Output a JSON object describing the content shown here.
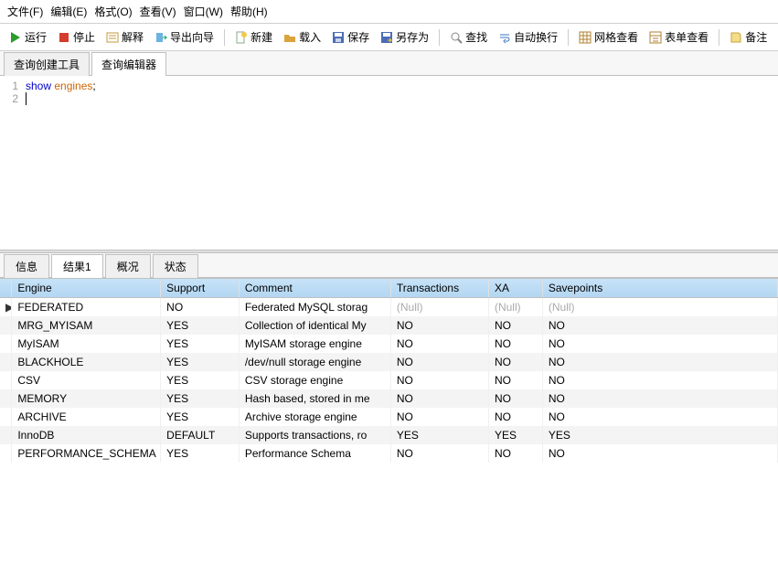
{
  "menu": {
    "file": "文件(F)",
    "edit": "编辑(E)",
    "format": "格式(O)",
    "view": "查看(V)",
    "window": "窗口(W)",
    "help": "帮助(H)"
  },
  "toolbar": {
    "run": "运行",
    "stop": "停止",
    "explain": "解释",
    "export_wizard": "导出向导",
    "new": "新建",
    "load": "载入",
    "save": "保存",
    "saveas": "另存为",
    "find": "查找",
    "wrap": "自动换行",
    "gridview": "网格查看",
    "formview": "表单查看",
    "note": "备注"
  },
  "editor_tabs": {
    "builder": "查询创建工具",
    "editor": "查询编辑器"
  },
  "code": {
    "lines": [
      {
        "n": "1",
        "tokens": [
          [
            "show ",
            "kw1"
          ],
          [
            "engines",
            "kw2"
          ],
          [
            ";",
            ""
          ]
        ]
      },
      {
        "n": "2",
        "tokens": []
      }
    ]
  },
  "result_tabs": {
    "info": "信息",
    "r1": "结果1",
    "profile": "概况",
    "status": "状态"
  },
  "columns": [
    "Engine",
    "Support",
    "Comment",
    "Transactions",
    "XA",
    "Savepoints"
  ],
  "rows": [
    {
      "mark": "▶",
      "cells": [
        "FEDERATED",
        "NO",
        "Federated MySQL storag",
        "(Null)",
        "(Null)",
        "(Null)"
      ]
    },
    {
      "mark": "",
      "cells": [
        "MRG_MYISAM",
        "YES",
        "Collection of identical My",
        "NO",
        "NO",
        "NO"
      ]
    },
    {
      "mark": "",
      "cells": [
        "MyISAM",
        "YES",
        "MyISAM storage engine",
        "NO",
        "NO",
        "NO"
      ]
    },
    {
      "mark": "",
      "cells": [
        "BLACKHOLE",
        "YES",
        "/dev/null storage engine",
        "NO",
        "NO",
        "NO"
      ]
    },
    {
      "mark": "",
      "cells": [
        "CSV",
        "YES",
        "CSV storage engine",
        "NO",
        "NO",
        "NO"
      ]
    },
    {
      "mark": "",
      "cells": [
        "MEMORY",
        "YES",
        "Hash based, stored in me",
        "NO",
        "NO",
        "NO"
      ]
    },
    {
      "mark": "",
      "cells": [
        "ARCHIVE",
        "YES",
        "Archive storage engine",
        "NO",
        "NO",
        "NO"
      ]
    },
    {
      "mark": "",
      "cells": [
        "InnoDB",
        "DEFAULT",
        "Supports transactions, ro",
        "YES",
        "YES",
        "YES"
      ]
    },
    {
      "mark": "",
      "cells": [
        "PERFORMANCE_SCHEMA",
        "YES",
        "Performance Schema",
        "NO",
        "NO",
        "NO"
      ]
    }
  ],
  "colwidths": [
    "152",
    "80",
    "155",
    "100",
    "55",
    "240"
  ]
}
